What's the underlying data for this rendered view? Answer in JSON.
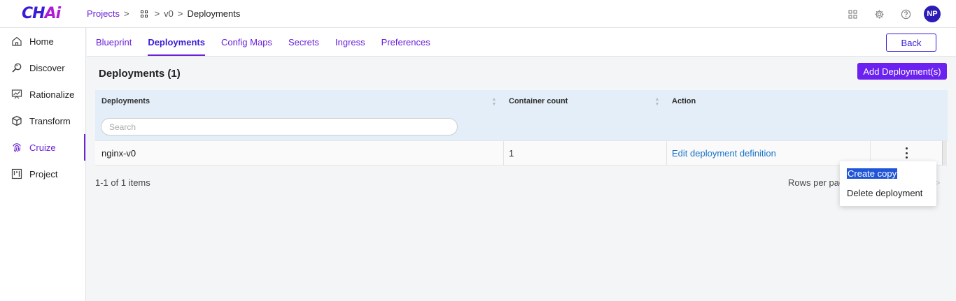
{
  "logo": {
    "main": "CH",
    "accent": "Ai"
  },
  "breadcrumb": {
    "projects": "Projects",
    "separator": ">",
    "version": "v0",
    "current": "Deployments"
  },
  "top_icons": [
    "apps-grid-icon",
    "gear-icon",
    "help-icon"
  ],
  "user": {
    "initials": "NP"
  },
  "sidebar": {
    "items": [
      {
        "label": "Home",
        "icon": "home-icon"
      },
      {
        "label": "Discover",
        "icon": "search-icon"
      },
      {
        "label": "Rationalize",
        "icon": "chart-board-icon"
      },
      {
        "label": "Transform",
        "icon": "cube-icon"
      },
      {
        "label": "Cruize",
        "icon": "fingerprint-icon",
        "active": true
      },
      {
        "label": "Project",
        "icon": "kanban-icon"
      }
    ]
  },
  "tabs": [
    {
      "label": "Blueprint"
    },
    {
      "label": "Deployments",
      "active": true
    },
    {
      "label": "Config Maps"
    },
    {
      "label": "Secrets"
    },
    {
      "label": "Ingress"
    },
    {
      "label": "Preferences"
    }
  ],
  "back_label": "Back",
  "section": {
    "title": "Deployments (1)",
    "add_label": "Add Deployment(s)"
  },
  "table": {
    "headers": [
      "Deployments",
      "Container count",
      "Action"
    ],
    "search_placeholder": "Search",
    "rows": [
      {
        "name": "nginx-v0",
        "container_count": "1",
        "action": "Edit deployment definition"
      }
    ]
  },
  "pager": {
    "info": "1-1 of 1 items",
    "rows_per_page": "Rows per page",
    "next_arrow": ">"
  },
  "menu": {
    "items": [
      "Create copy",
      "Delete deployment"
    ],
    "selected": "Create copy"
  },
  "colors": {
    "accent": "#6b21d8",
    "primary_button": "#6b21f0",
    "link": "#1a73c9",
    "table_header_bg": "#e3eef8"
  }
}
